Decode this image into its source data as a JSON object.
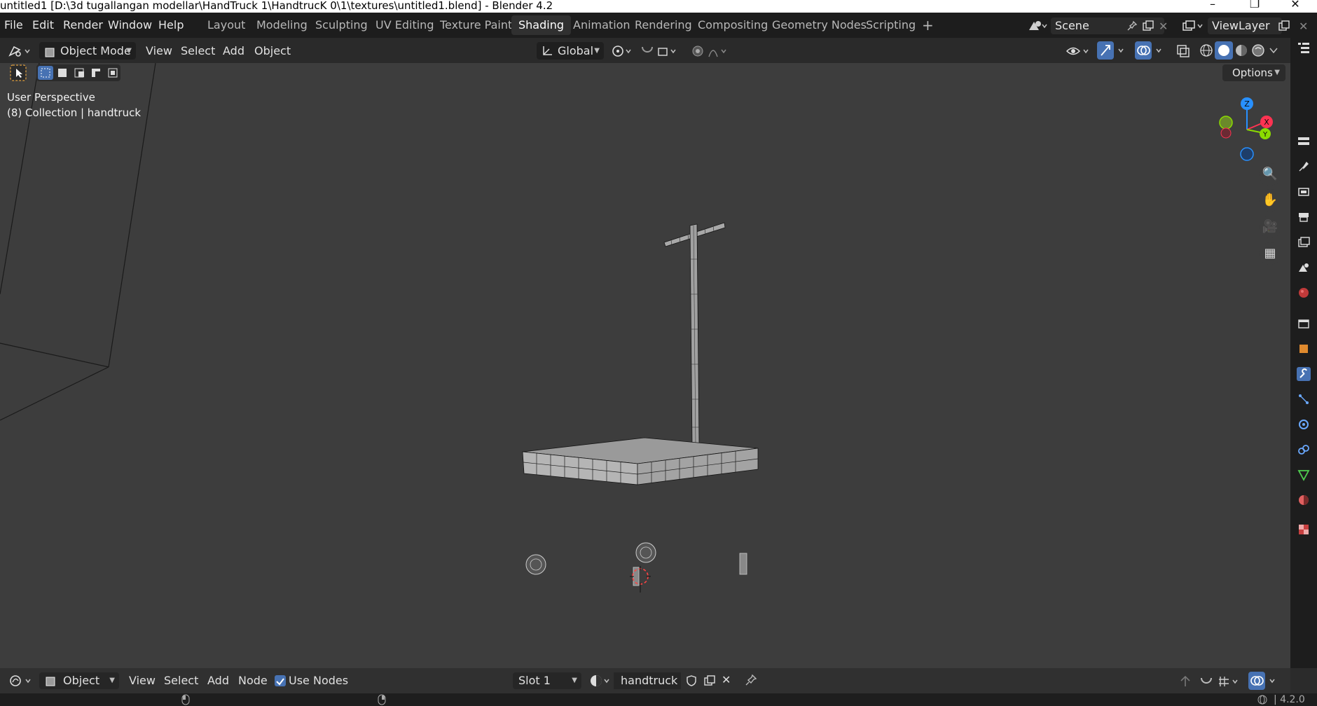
{
  "window": {
    "title": "untitled1 [D:\\3d tugallangan modellar\\HandTruck 1\\HandtrucK 0\\1\\textures\\untitled1.blend] - Blender 4.2",
    "minimize": "–",
    "maximize": "❐",
    "close": "✕"
  },
  "menu": {
    "file": "File",
    "edit": "Edit",
    "render": "Render",
    "window": "Window",
    "help": "Help"
  },
  "workspaces": [
    "Layout",
    "Modeling",
    "Sculpting",
    "UV Editing",
    "Texture Paint",
    "Shading",
    "Animation",
    "Rendering",
    "Compositing",
    "Geometry Nodes",
    "Scripting"
  ],
  "active_workspace": "Shading",
  "scene": {
    "name": "Scene",
    "view_layer": "ViewLayer"
  },
  "viewport_header": {
    "mode": "Object Mode",
    "view": "View",
    "select": "Select",
    "add": "Add",
    "object": "Object",
    "orientation": "Global",
    "options": "Options"
  },
  "viewport": {
    "perspective": "User Perspective",
    "collection_info": "(8) Collection | handtruck"
  },
  "gizmo": {
    "x": "X",
    "y": "Y",
    "z": "Z"
  },
  "bottom_bar": {
    "editor_mode": "Object",
    "view": "View",
    "select": "Select",
    "add": "Add",
    "node": "Node",
    "use_nodes": "Use Nodes",
    "use_nodes_checked": true,
    "slot": "Slot 1",
    "material": "handtruck"
  },
  "status": {
    "version": "4.2.0"
  },
  "colors": {
    "accent_blue": "#4772b3",
    "axis_x": "#ff3352",
    "axis_y": "#8bdc00",
    "axis_z": "#2890ff"
  }
}
